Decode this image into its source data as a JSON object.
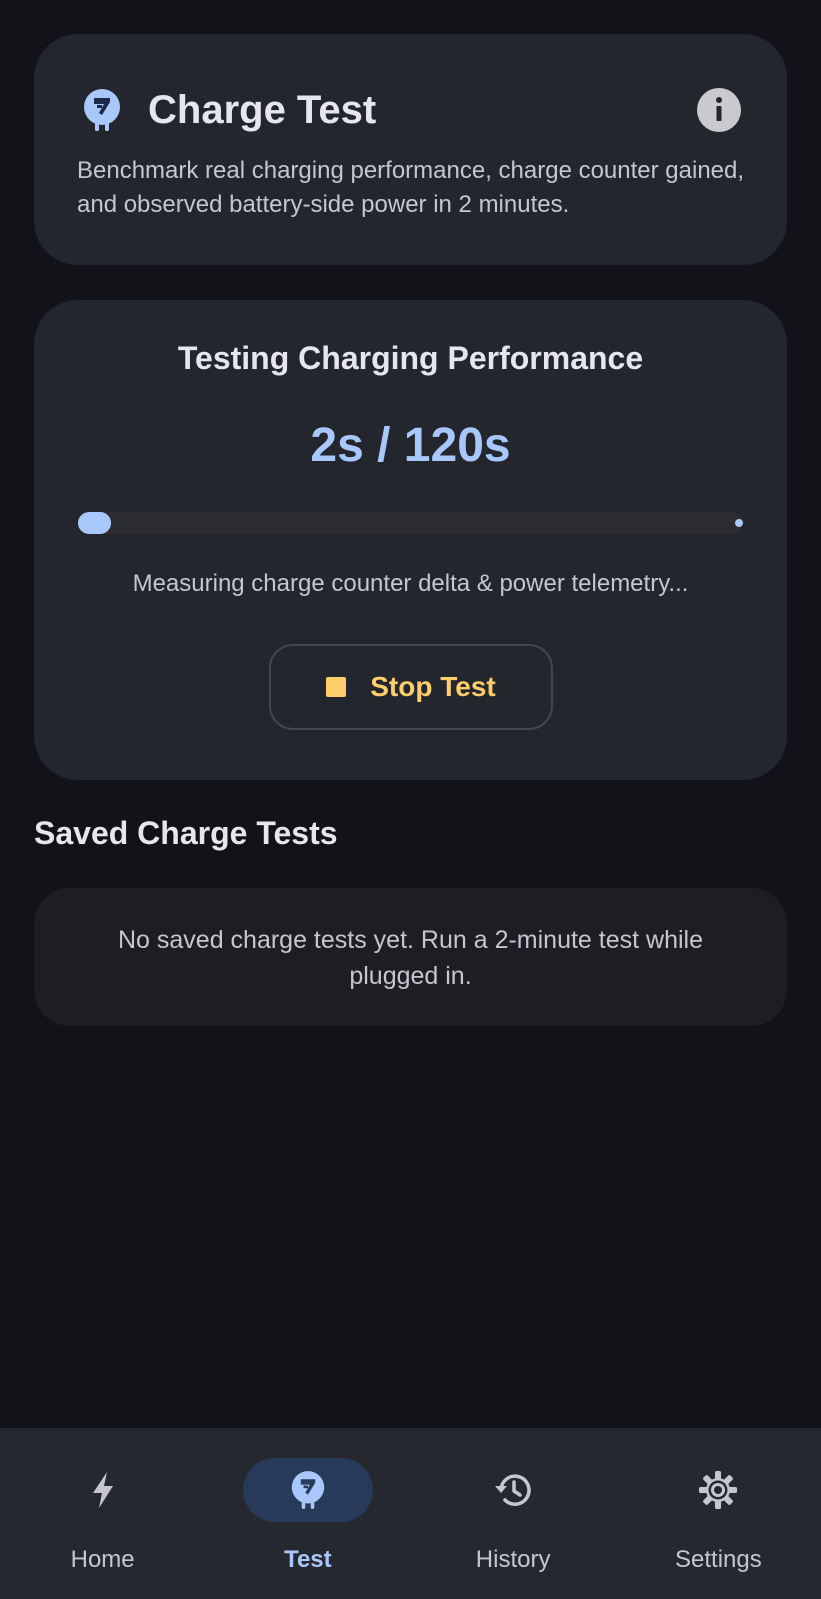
{
  "header": {
    "title": "Charge Test",
    "description": "Benchmark real charging performance, charge counter gained, and observed battery-side power in 2 minutes.",
    "app_icon": "charge-test-icon",
    "info_icon": "info-icon"
  },
  "test": {
    "title": "Testing Charging Performance",
    "progress_text": "2s / 120s",
    "elapsed_s": 2,
    "total_s": 120,
    "status": "Measuring charge counter delta & power telemetry...",
    "stop_label": "Stop Test",
    "stop_icon": "stop-icon"
  },
  "saved": {
    "title": "Saved Charge Tests",
    "empty_message": "No saved charge tests yet. Run a 2-minute test while plugged in."
  },
  "nav": {
    "items": [
      {
        "label": "Home",
        "icon": "bolt-icon",
        "active": false
      },
      {
        "label": "Test",
        "icon": "charge-test-icon",
        "active": true
      },
      {
        "label": "History",
        "icon": "history-icon",
        "active": false
      },
      {
        "label": "Settings",
        "icon": "gear-icon",
        "active": false
      }
    ]
  },
  "colors": {
    "background": "#121318",
    "card": "#24262e",
    "accent": "#a8c7fa",
    "warning": "#ffcd6b",
    "nav_background": "#262830",
    "nav_active_pill": "#273a59"
  }
}
